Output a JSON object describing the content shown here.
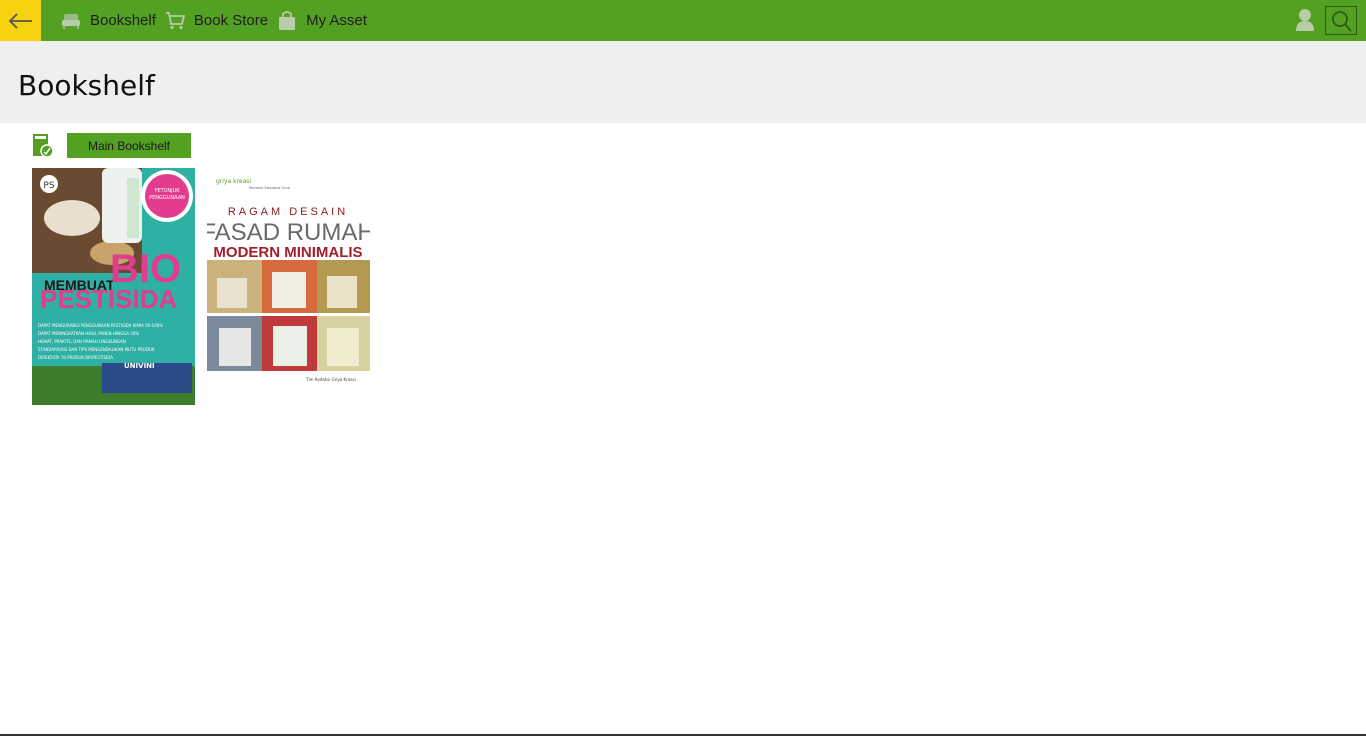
{
  "nav": {
    "items": [
      {
        "label": "Bookshelf",
        "icon": "sofa-icon"
      },
      {
        "label": "Book Store",
        "icon": "cart-icon"
      },
      {
        "label": "My Asset",
        "icon": "bag-icon"
      }
    ]
  },
  "header": {
    "title": "Bookshelf"
  },
  "shelf": {
    "button_label": "Main Bookshelf"
  },
  "books": [
    {
      "title_line1": "MEMBUAT",
      "title_line2": "BIO",
      "title_line3": "PESTISIDA",
      "badge": "PETUNJUK PENGGUNAAN UNTUK BERBAGAI TANAMAN",
      "publisher": "PS",
      "bullets": [
        "DAPAT MENGURANGI PENGGUNAAN PESTISIDA KIMIA 50-100%",
        "DAPAT MENINGKATKAN HASIL PANEN HINGGA 30%",
        "HEMAT, PRAKTIS, DAN RAMAH LINGKUNGAN",
        "STANDARISASI DAN TIPS MENGENDALIKAN MUTU PRODUK",
        "DIREKTORI 78 PRODUK BIOPESTISIDA"
      ],
      "author": "UNIVINI"
    },
    {
      "publisher": "griya kreasi",
      "publisher_sub": "Penebar Swadaya Grup",
      "title_line1": "RAGAM DESAIN",
      "title_line2": "FASAD RUMAH",
      "title_line3": "MODERN MINIMALIS",
      "author": "Tim Redaksi Griya Kreasi"
    }
  ],
  "colors": {
    "accent": "#53a022",
    "back": "#f7d20e",
    "header_bg": "#efefef"
  }
}
